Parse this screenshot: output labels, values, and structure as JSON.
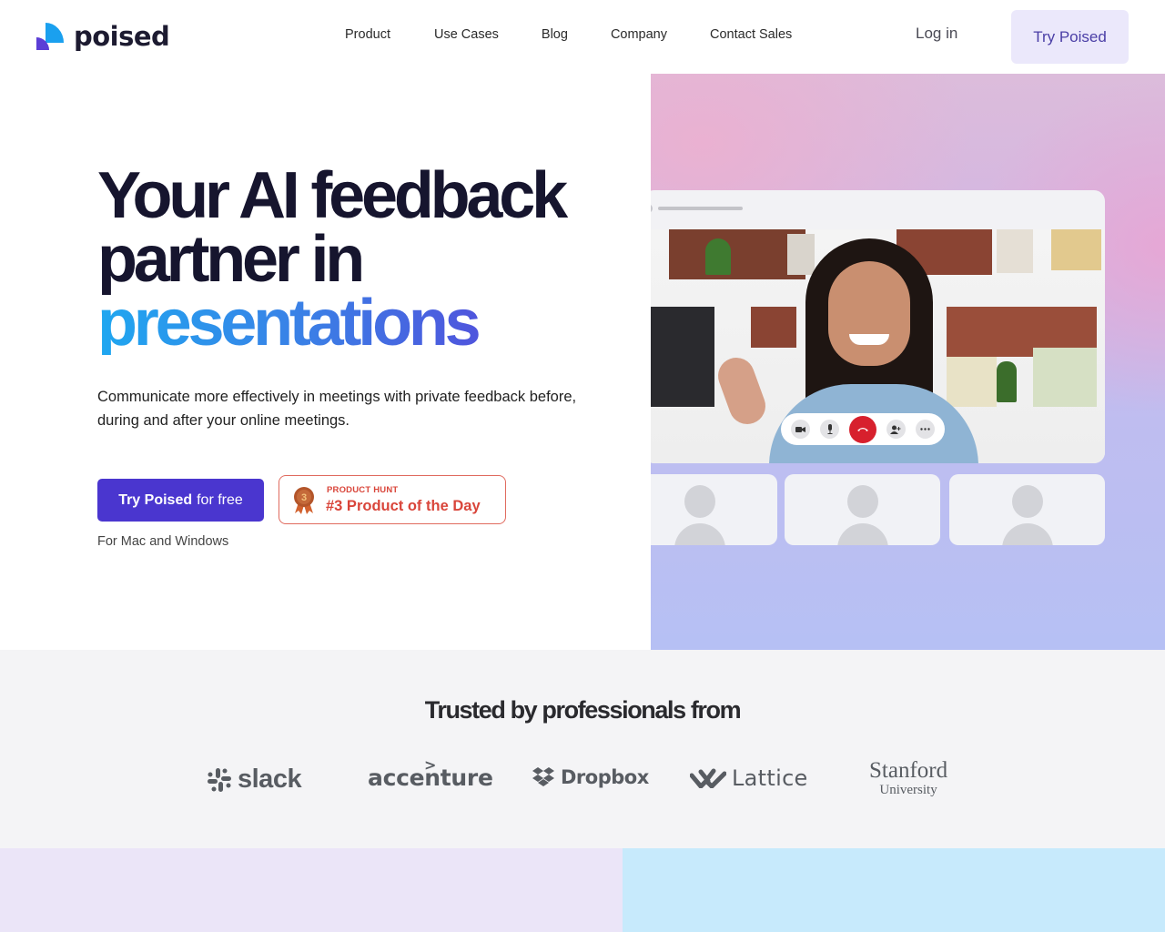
{
  "nav": {
    "brand": "poised",
    "links": [
      "Product",
      "Use Cases",
      "Blog",
      "Company",
      "Contact Sales"
    ],
    "login": "Log in",
    "cta": "Try Poised"
  },
  "hero": {
    "title_line1": "Your AI feedback",
    "title_line2": "partner in",
    "title_line3": "presentations",
    "subtitle": "Communicate more effectively in meetings with private feedback before, during and after your online meetings.",
    "cta_bold": "Try Poised",
    "cta_rest": "for free",
    "cta_note": "For Mac and Windows",
    "badge": {
      "label": "PRODUCT HUNT",
      "title": "#3 Product of the Day",
      "medal_number": "3"
    }
  },
  "call_preview": {
    "controls": [
      "camera-icon",
      "microphone-icon",
      "end-call-icon",
      "add-participant-icon",
      "more-icon"
    ],
    "participant_tiles": 3
  },
  "trusted": {
    "title": "Trusted by professionals from",
    "logos": [
      {
        "name": "slack",
        "text": "slack"
      },
      {
        "name": "accenture",
        "text": "accenture"
      },
      {
        "name": "dropbox",
        "text": "Dropbox"
      },
      {
        "name": "lattice",
        "text": "Lattice"
      },
      {
        "name": "stanford",
        "text": "Stanford",
        "subtext": "University"
      }
    ]
  },
  "colors": {
    "primary": "#4a36cf",
    "accent_light": "#ebe8fb",
    "badge_red": "#d9453a",
    "end_call_red": "#d7202d",
    "gradient_start": "#1fa7f0",
    "gradient_end": "#5940d8"
  }
}
